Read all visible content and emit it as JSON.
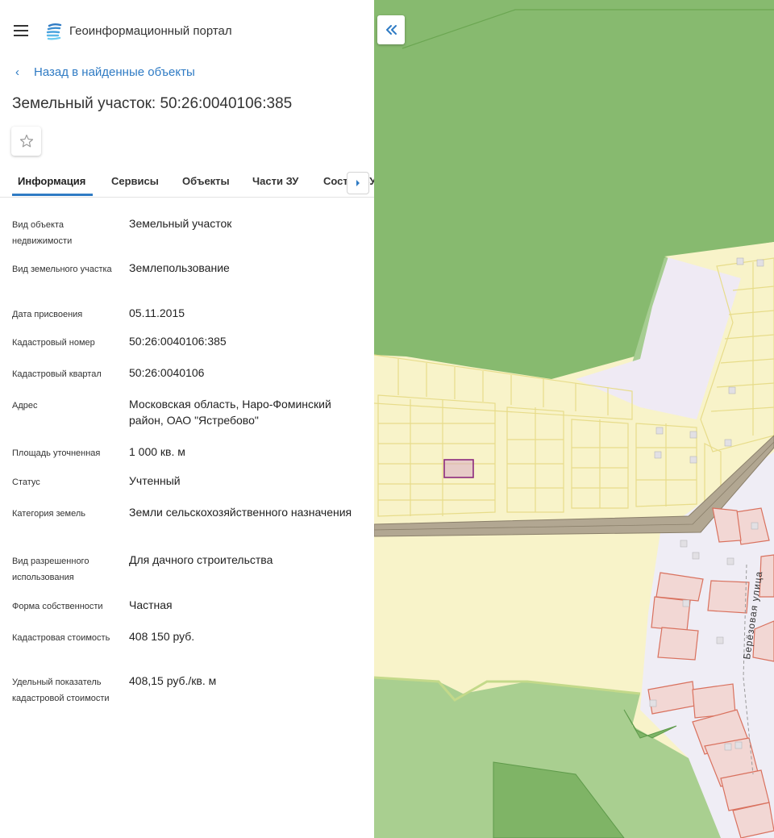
{
  "header": {
    "app_title": "Геоинформационный портал",
    "menu_icon": "menu-icon",
    "logo_icon": "portal-logo-icon"
  },
  "nav": {
    "back_label": "Назад в найденные объекты"
  },
  "object": {
    "title": "Земельный участок: 50:26:0040106:385"
  },
  "tabs": [
    {
      "label": "Информация",
      "active": true
    },
    {
      "label": "Сервисы"
    },
    {
      "label": "Объекты"
    },
    {
      "label": "Части ЗУ"
    },
    {
      "label": "Состав ЗУ"
    }
  ],
  "info": [
    {
      "label": "Вид объекта недвижимости",
      "value": "Земельный участок"
    },
    {
      "label": "Вид земельного участка",
      "value": "Землепользование"
    },
    {
      "label": "Дата присвоения",
      "value": "05.11.2015"
    },
    {
      "label": "Кадастровый номер",
      "value": "50:26:0040106:385"
    },
    {
      "label": "Кадастровый квартал",
      "value": "50:26:0040106"
    },
    {
      "label": "Адрес",
      "value": "Московская область, Наро-Фоминский район, ОАО \"Ястребово\""
    },
    {
      "label": "Площадь уточненная",
      "value": "1 000 кв. м"
    },
    {
      "label": "Статус",
      "value": "Учтенный"
    },
    {
      "label": "Категория земель",
      "value": "Земли сельскохозяйственного назначения"
    },
    {
      "label": "Вид разрешенного использования",
      "value": "Для дачного строительства"
    },
    {
      "label": "Форма собственности",
      "value": "Частная"
    },
    {
      "label": "Кадастровая стоимость",
      "value": "408 150 руб."
    },
    {
      "label": "Удельный показатель кадастровой стоимости",
      "value": "408,15 руб./кв. м"
    }
  ],
  "map": {
    "street_label": "Берёзовая улица"
  },
  "colors": {
    "accent": "#2f7bc4",
    "forest": "#87ba6f",
    "plots": "#f8f3c9",
    "road": "#b2a792",
    "buildings": "#f2d7d4",
    "selected": "#8c2a7e"
  }
}
